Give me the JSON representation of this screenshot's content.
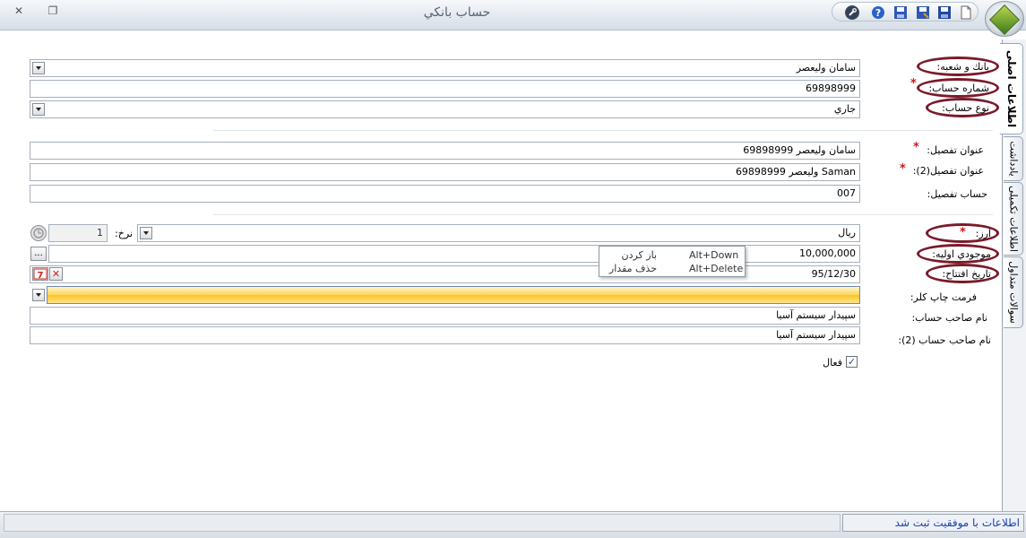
{
  "window": {
    "title": "حساب بانکي",
    "close_glyph": "✕",
    "restore_glyph": "❐"
  },
  "toolbar": {
    "icons": [
      "wrench-icon",
      "help-icon",
      "save-icon",
      "save-as-icon",
      "save-close-icon",
      "new-document-icon"
    ]
  },
  "tabs": [
    {
      "label": "اطلاعات اصلی",
      "active": true
    },
    {
      "label": "یادداشت",
      "active": false
    },
    {
      "label": "اطلاعات تکمیلی",
      "active": false
    },
    {
      "label": "سوالات متداول",
      "active": false
    }
  ],
  "form": {
    "bank_branch": {
      "label": "بانك و شعبه:",
      "value": "سامان وليعصر"
    },
    "account_number": {
      "label": "شماره حساب:",
      "value": "69898999"
    },
    "account_type": {
      "label": "نوع حساب:",
      "value": "جاري"
    },
    "detail_title": {
      "label": "عنوان تفصيل:",
      "value": "سامان وليعصر 69898999"
    },
    "detail_title2": {
      "label": "عنوان تفصيل(2):",
      "value": "Saman وليعصر 69898999"
    },
    "detail_account": {
      "label": "حساب تفصيل:",
      "value": "007"
    },
    "currency": {
      "label": "ارز:",
      "value": "ريال"
    },
    "rate": {
      "label": "نرخ:",
      "value": "1"
    },
    "opening_balance": {
      "label": "موجودي اوليه:",
      "value": "10,000,000",
      "more_glyph": "..."
    },
    "opening_date": {
      "label": "تاريخ افتتاح:",
      "value": "95/12/30"
    },
    "check_print_format": {
      "label": "فرمت چاپ كلر:",
      "value": ""
    },
    "account_holder": {
      "label": "نام صاحب حساب:",
      "value": "سپيدار سيستم آسيا"
    },
    "account_holder2": {
      "label": "نام صاحب حساب (2):",
      "value": "سپيدار سيستم آسيا"
    },
    "active": {
      "label": "فعال",
      "checked": true,
      "glyph": "✓"
    },
    "required_mark": "*"
  },
  "tooltip": {
    "rows": [
      {
        "key": "Alt+Down",
        "action": "باز كردن"
      },
      {
        "key": "Alt+Delete",
        "action": "حذف مقدار"
      }
    ]
  },
  "status": {
    "message": "اطلاعات با موفقيت ثبت شد"
  },
  "colors": {
    "highlight_ring": "#7a1a2a",
    "required": "#d01818",
    "status_text": "#1c3fb1"
  }
}
